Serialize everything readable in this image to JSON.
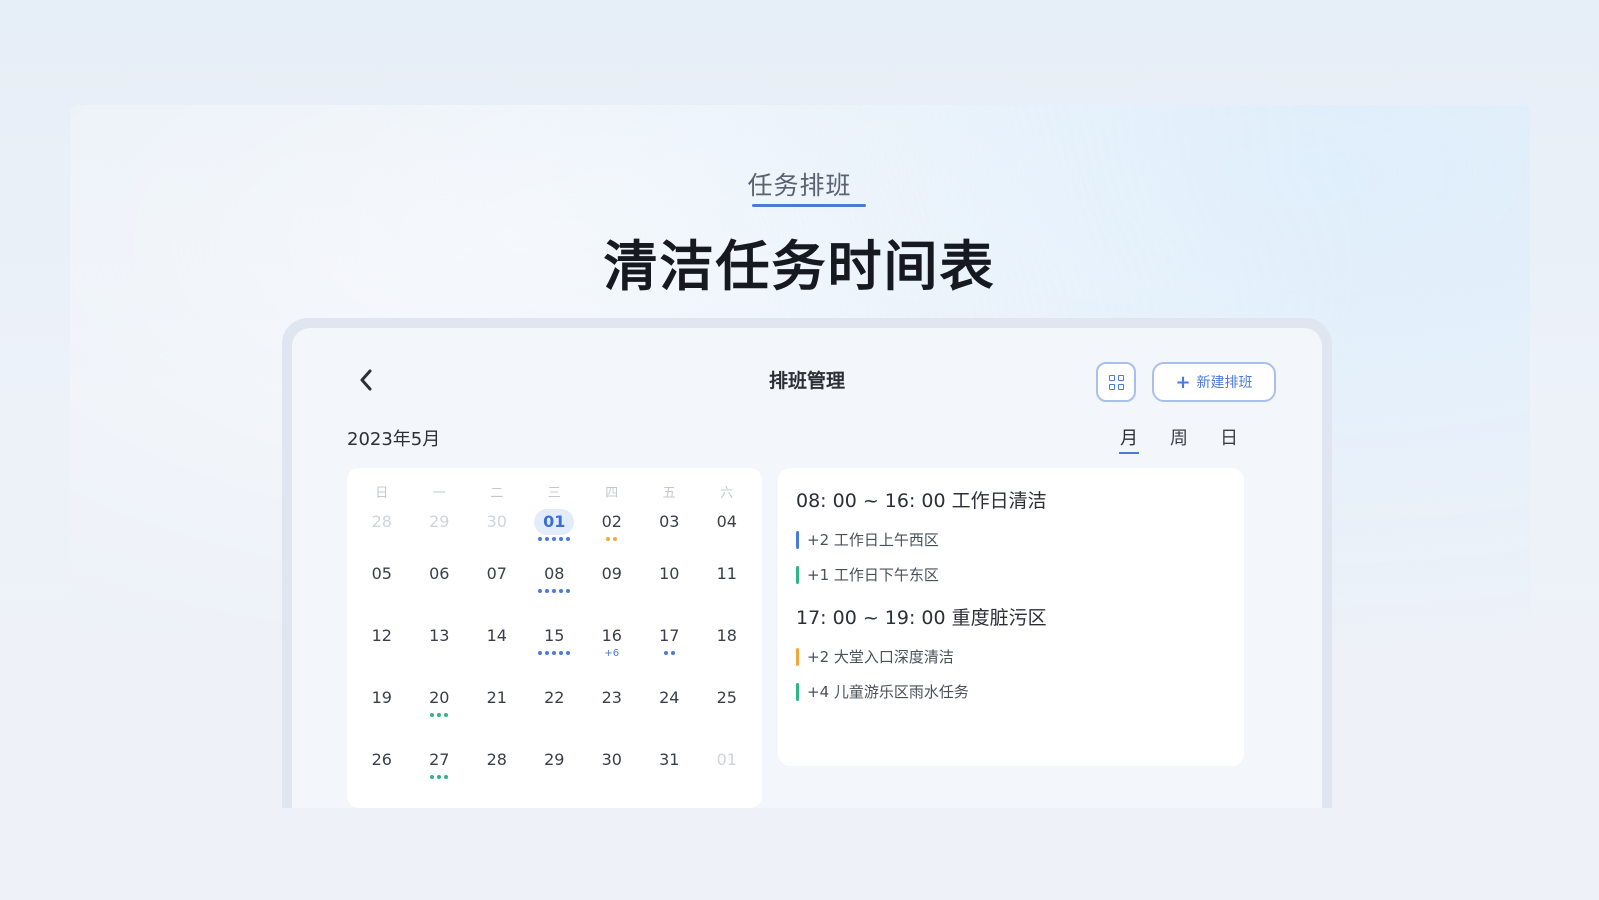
{
  "header": {
    "eyebrow": "任务排班",
    "headline": "清洁任务时间表"
  },
  "app": {
    "title": "排班管理",
    "back_icon": "chevron-left-icon",
    "grid_icon": "grid-view-icon",
    "new_button": {
      "icon": "plus-icon",
      "label": "新建排班"
    },
    "month_label": "2023年5月",
    "view_tabs": [
      {
        "label": "月",
        "active": true
      },
      {
        "label": "周",
        "active": false
      },
      {
        "label": "日",
        "active": false
      }
    ]
  },
  "calendar": {
    "weekdays": [
      "日",
      "一",
      "二",
      "三",
      "四",
      "五",
      "六"
    ],
    "weeks": [
      [
        {
          "d": "28",
          "other": true
        },
        {
          "d": "29",
          "other": true
        },
        {
          "d": "30",
          "other": true
        },
        {
          "d": "01",
          "today": true,
          "dots": [
            "#4a7bd9",
            "#4a7bd9",
            "#4a7bd9",
            "#4a7bd9",
            "#4a7bd9"
          ]
        },
        {
          "d": "02",
          "dots": [
            "#f2a93b",
            "#f2a93b"
          ]
        },
        {
          "d": "03"
        },
        {
          "d": "04"
        }
      ],
      [
        {
          "d": "05"
        },
        {
          "d": "06"
        },
        {
          "d": "07"
        },
        {
          "d": "08",
          "dots": [
            "#4a7bd9",
            "#4a7bd9",
            "#4a7bd9",
            "#4a7bd9",
            "#4a7bd9"
          ]
        },
        {
          "d": "09"
        },
        {
          "d": "10"
        },
        {
          "d": "11"
        }
      ],
      [
        {
          "d": "12"
        },
        {
          "d": "13"
        },
        {
          "d": "14"
        },
        {
          "d": "15",
          "dots": [
            "#4a7bd9",
            "#4a7bd9",
            "#4a7bd9",
            "#4a7bd9",
            "#4a7bd9"
          ]
        },
        {
          "d": "16",
          "more": "+6"
        },
        {
          "d": "17",
          "dots": [
            "#4a7bd9",
            "#4a7bd9"
          ]
        },
        {
          "d": "18"
        }
      ],
      [
        {
          "d": "19"
        },
        {
          "d": "20",
          "dots": [
            "#2fb58a",
            "#2fb58a",
            "#2fb58a"
          ]
        },
        {
          "d": "21"
        },
        {
          "d": "22"
        },
        {
          "d": "23"
        },
        {
          "d": "24"
        },
        {
          "d": "25"
        }
      ],
      [
        {
          "d": "26"
        },
        {
          "d": "27",
          "dots": [
            "#2fb58a",
            "#2fb58a",
            "#2fb58a"
          ]
        },
        {
          "d": "28"
        },
        {
          "d": "29"
        },
        {
          "d": "30"
        },
        {
          "d": "31"
        },
        {
          "d": "01",
          "other": true
        }
      ]
    ]
  },
  "tasks": [
    {
      "title": "08: 00 ~ 16: 00 工作日清洁",
      "items": [
        {
          "text": "+2 工作日上午西区",
          "color": "#4a7bd9"
        },
        {
          "text": "+1 工作日下午东区",
          "color": "#2fb58a"
        }
      ]
    },
    {
      "title": "17: 00 ~ 19: 00 重度脏污区",
      "items": [
        {
          "text": "+2 大堂入口深度清洁",
          "color": "#f2a93b"
        },
        {
          "text": "+4 儿童游乐区雨水任务",
          "color": "#2fb58a"
        }
      ]
    }
  ]
}
